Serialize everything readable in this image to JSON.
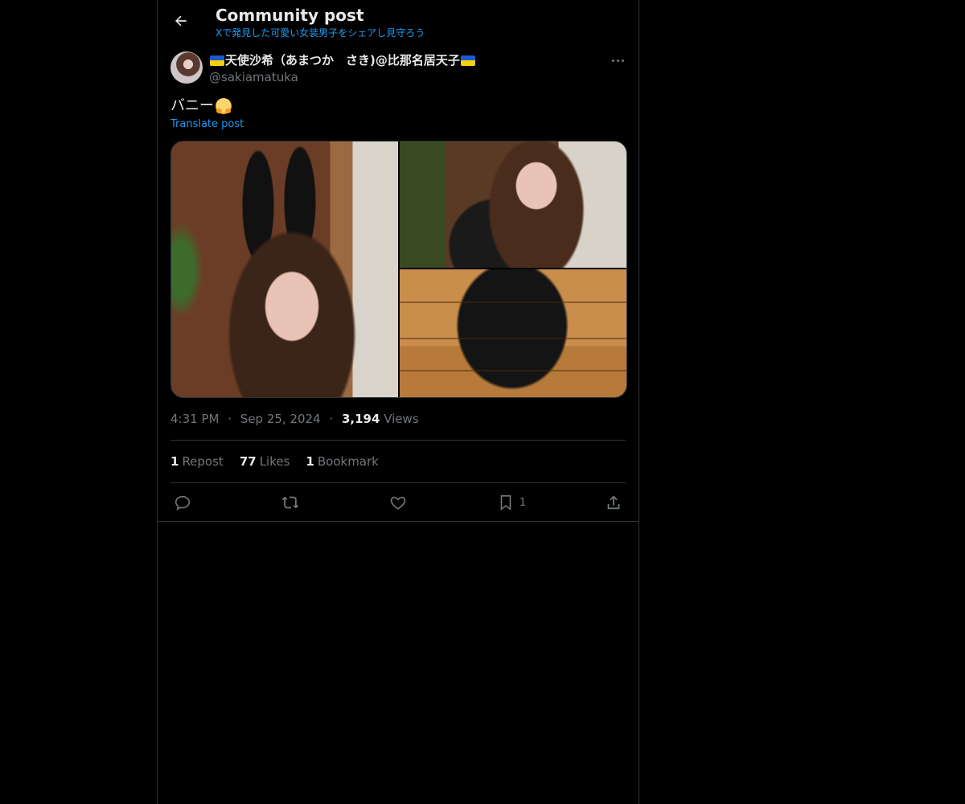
{
  "header": {
    "title": "Community post",
    "subtitle": "Xで発見した可愛い女装男子をシェアし見守ろう"
  },
  "post": {
    "display_name": "天使沙希（あまつか　さき)@比那名居天子",
    "handle": "@sakiamatuka",
    "text": "バニー",
    "emoji": "hugging-face",
    "translate_label": "Translate post",
    "time": "4:31 PM",
    "date": "Sep 25, 2024",
    "views_count": "3,194",
    "views_label": "Views",
    "separator": "·"
  },
  "stats": {
    "reposts_count": "1",
    "reposts_label": "Repost",
    "likes_count": "77",
    "likes_label": "Likes",
    "bookmarks_count": "1",
    "bookmarks_label": "Bookmark"
  },
  "actions": {
    "reply_icon": "reply-icon",
    "repost_icon": "repost-icon",
    "like_icon": "heart-icon",
    "bookmark_icon": "bookmark-icon",
    "bookmark_count": "1",
    "share_icon": "share-icon"
  },
  "colors": {
    "background": "#000000",
    "text": "#e7e9ea",
    "secondary": "#71767b",
    "accent": "#1d9bf0",
    "border": "#2f3336"
  }
}
